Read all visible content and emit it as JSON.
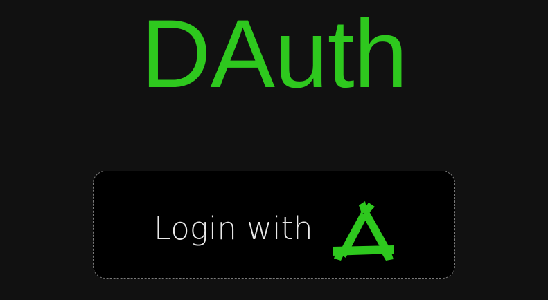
{
  "app": {
    "title": "DAuth",
    "accent_color": "#2ec81e",
    "background_color": "#111111"
  },
  "login_button": {
    "label": "Login with",
    "icon": "dauth-logo-icon",
    "background_color": "#000000",
    "text_color": "#e9e9e9"
  }
}
